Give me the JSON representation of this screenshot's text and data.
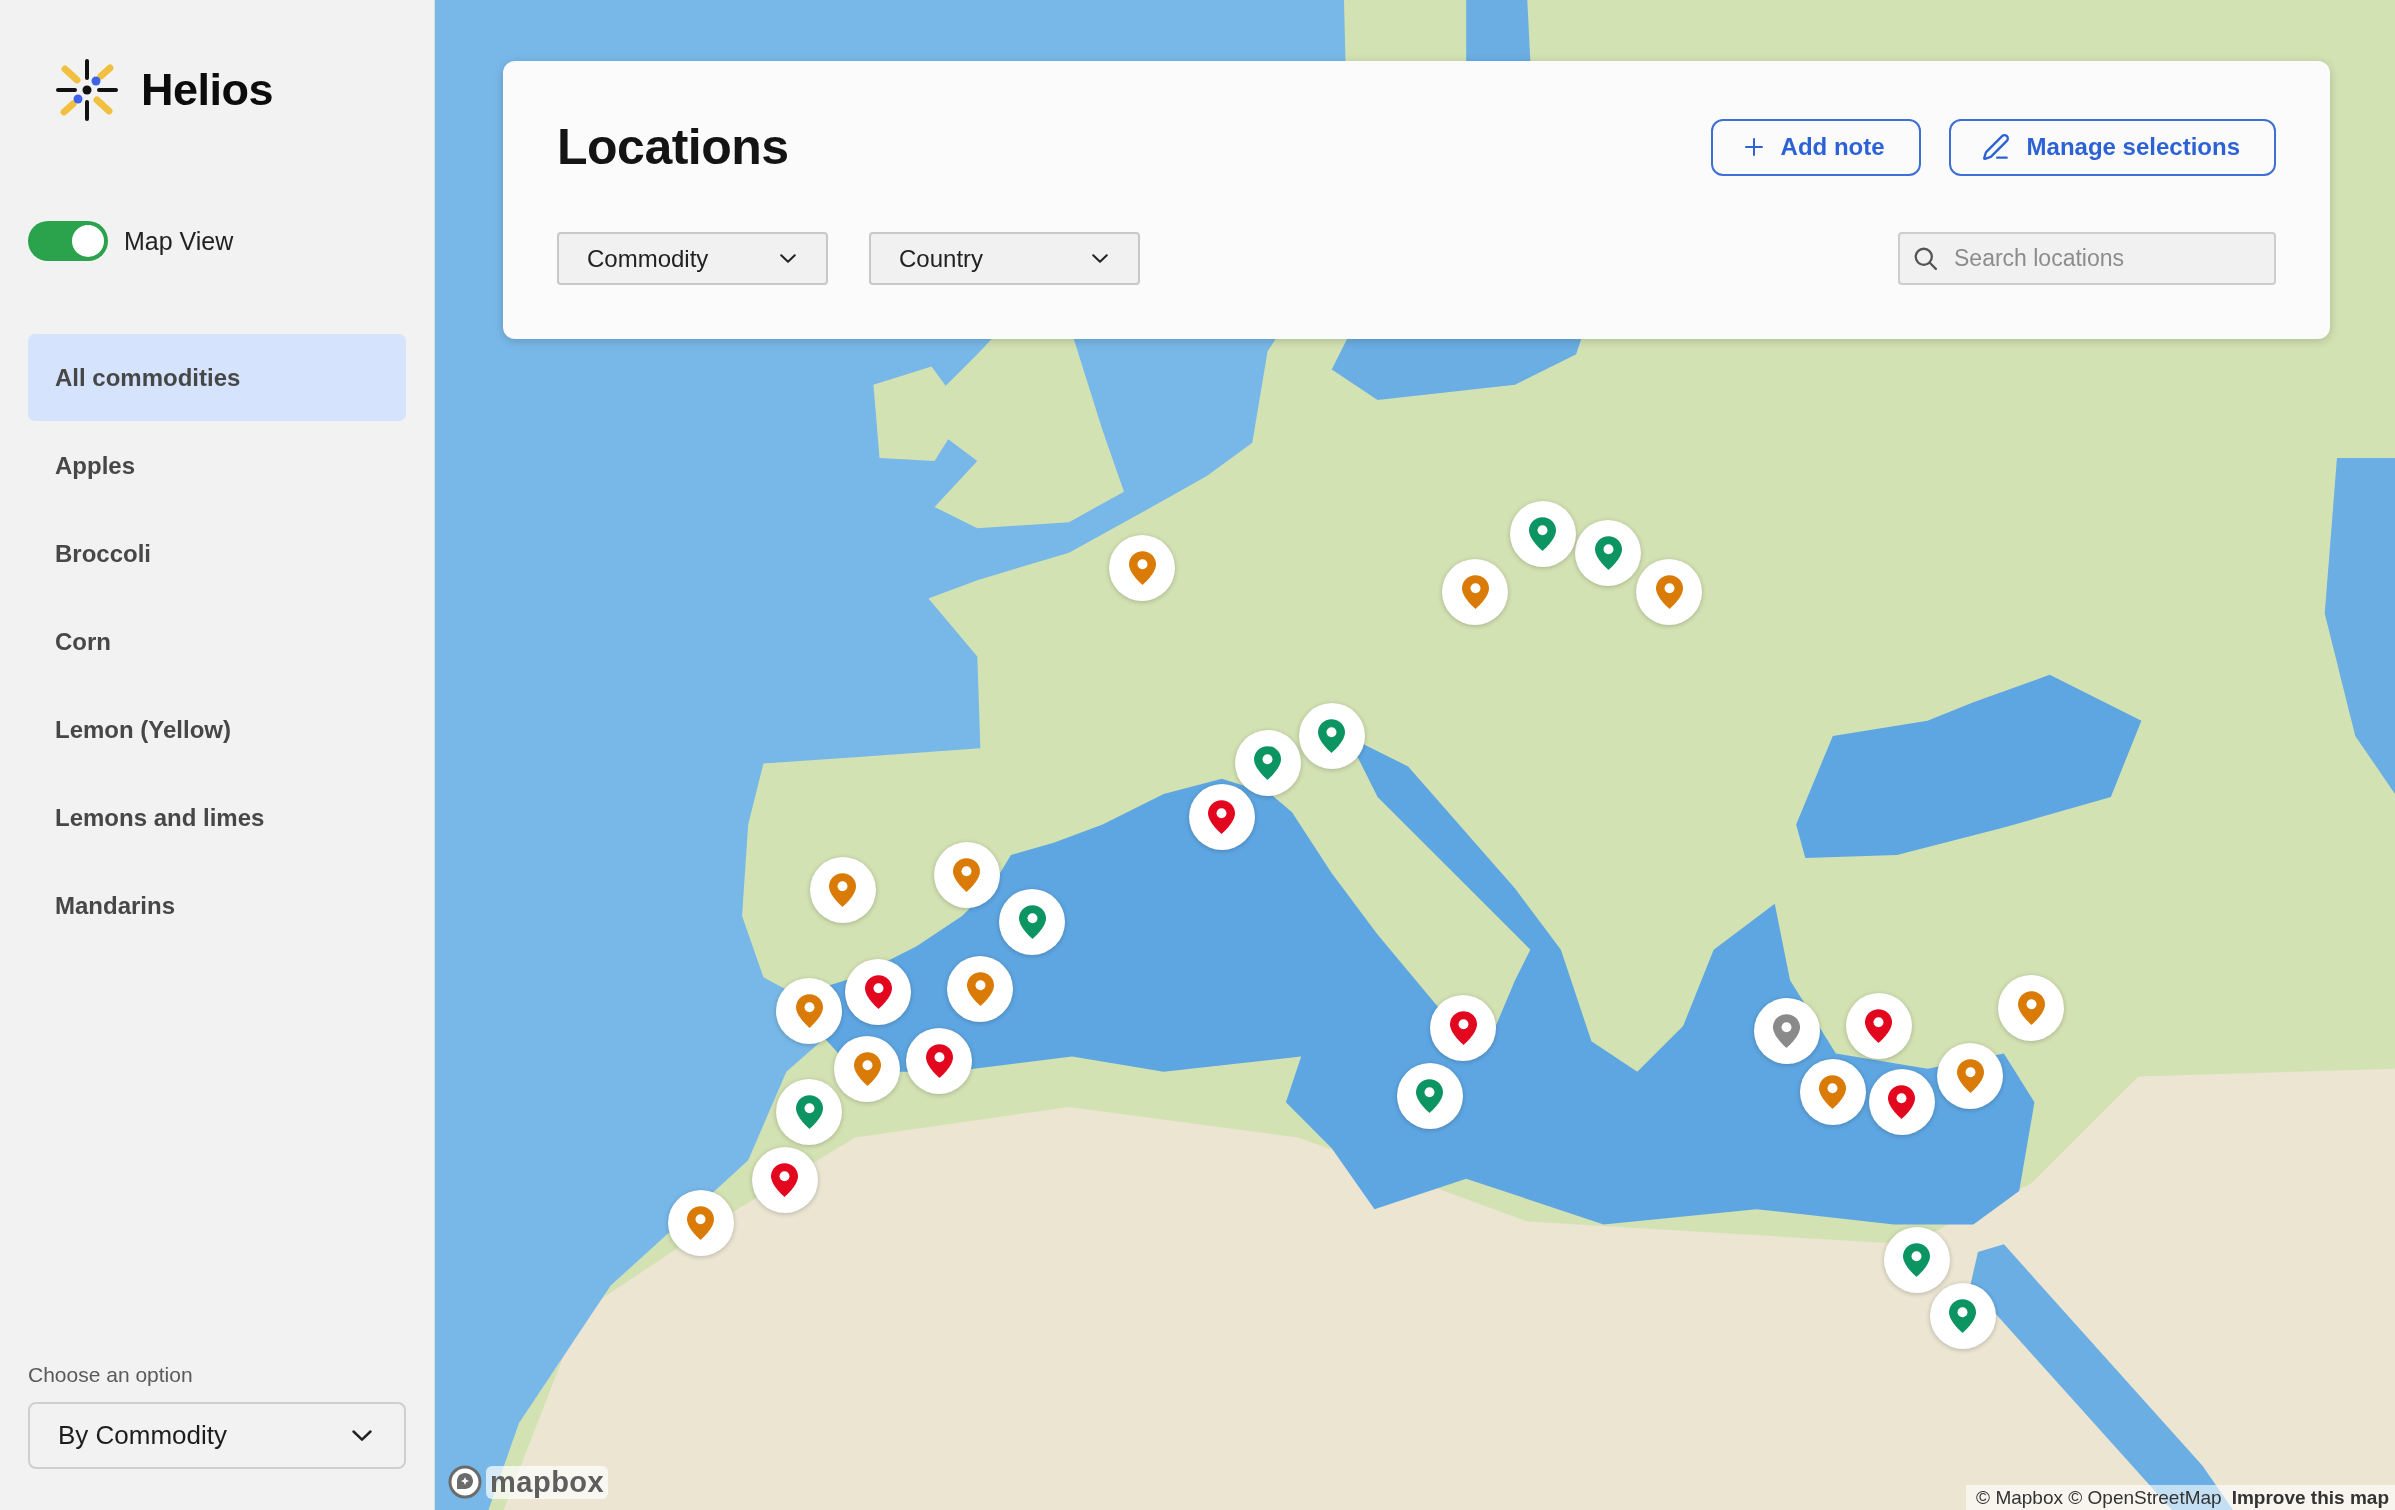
{
  "sidebar": {
    "logo": {
      "name": "Helios"
    },
    "map_view_toggle": {
      "label": "Map View",
      "on": true
    },
    "items": [
      {
        "label": "All commodities",
        "selected": true
      },
      {
        "label": "Apples",
        "selected": false
      },
      {
        "label": "Broccoli",
        "selected": false
      },
      {
        "label": "Corn",
        "selected": false
      },
      {
        "label": "Lemon (Yellow)",
        "selected": false
      },
      {
        "label": "Lemons and limes",
        "selected": false
      },
      {
        "label": "Mandarins",
        "selected": false
      }
    ],
    "option_select": {
      "label": "Choose an option",
      "value": "By Commodity"
    }
  },
  "header": {
    "title": "Locations",
    "buttons": [
      {
        "label": "Add note",
        "kind": "add"
      },
      {
        "label": "Manage selections",
        "kind": "edit"
      }
    ],
    "filters": [
      "Commodity",
      "Country"
    ],
    "search": {
      "placeholder": "Search locations"
    }
  },
  "map": {
    "markers": [
      {
        "color": "#d97b06"
      },
      {
        "color": "#0d9463"
      },
      {
        "color": "#0d9463"
      },
      {
        "color": "#d97b06"
      },
      {
        "color": "#d97b06"
      },
      {
        "color": "#0d9463"
      },
      {
        "color": "#0d9463"
      },
      {
        "color": "#e3061f"
      },
      {
        "color": "#d97b06"
      },
      {
        "color": "#d97b06"
      },
      {
        "color": "#0d9463"
      },
      {
        "color": "#d97b06"
      },
      {
        "color": "#e3061f"
      },
      {
        "color": "#d97b06"
      },
      {
        "color": "#e3061f"
      },
      {
        "color": "#d97b06"
      },
      {
        "color": "#0d9463"
      },
      {
        "color": "#e3061f"
      },
      {
        "color": "#d97b06"
      },
      {
        "color": "#e3061f"
      },
      {
        "color": "#0d9463"
      },
      {
        "color": "#8a8a8a"
      },
      {
        "color": "#e3061f"
      },
      {
        "color": "#d97b06"
      },
      {
        "color": "#e3061f"
      },
      {
        "color": "#d97b06"
      },
      {
        "color": "#d97b06"
      },
      {
        "color": "#0d9463"
      },
      {
        "color": "#0d9463"
      }
    ],
    "logo": "mapbox",
    "attribution": {
      "text": "© Mapbox © OpenStreetMap",
      "link": "Improve this map"
    }
  }
}
